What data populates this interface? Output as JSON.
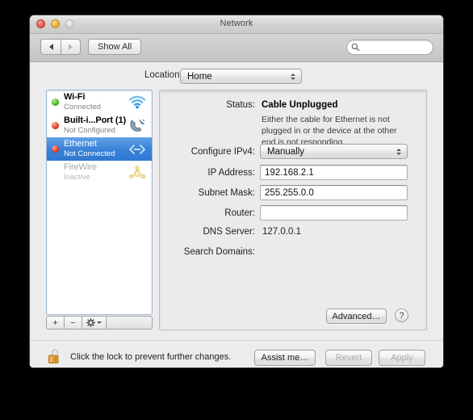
{
  "window": {
    "title": "Network",
    "traffic_lights": [
      "close-button",
      "minimize-button",
      "zoom-button"
    ]
  },
  "toolbar": {
    "back_label": "",
    "forward_label": "",
    "show_all_label": "Show All",
    "search_placeholder": "",
    "search_value": ""
  },
  "location": {
    "label": "Location:",
    "selected": "Home"
  },
  "sidebar": {
    "interfaces": [
      {
        "name": "Wi-Fi",
        "status": "Connected",
        "dot": "green",
        "icon": "wifi-icon",
        "selected": false,
        "dim": false
      },
      {
        "name": "Built-i...Port (1)",
        "status": "Not Configured",
        "dot": "red",
        "icon": "modem-icon",
        "selected": false,
        "dim": false
      },
      {
        "name": "Ethernet",
        "status": "Not Connected",
        "dot": "red",
        "icon": "ethernet-icon",
        "selected": true,
        "dim": false
      },
      {
        "name": "FireWire",
        "status": "Inactive",
        "dot": "none",
        "icon": "firewire-icon",
        "selected": false,
        "dim": true
      }
    ],
    "controls": {
      "add": "+",
      "remove": "−",
      "action": "gear-icon"
    }
  },
  "detail": {
    "status_label": "Status:",
    "status_value": "Cable Unplugged",
    "status_help": "Either the cable for Ethernet is not plugged in or the device at the other end is not responding.",
    "configure_label": "Configure IPv4:",
    "configure_value": "Manually",
    "ip_label": "IP Address:",
    "ip_value": "192.168.2.1",
    "subnet_label": "Subnet Mask:",
    "subnet_value": "255.255.0.0",
    "router_label": "Router:",
    "router_value": "",
    "dns_label": "DNS Server:",
    "dns_value": "127.0.0.1",
    "search_domains_label": "Search Domains:",
    "search_domains_value": "",
    "advanced_label": "Advanced…",
    "help_label": "?"
  },
  "footer": {
    "lock_icon": "unlocked-padlock-icon",
    "lock_text": "Click the lock to prevent further changes.",
    "assist_label": "Assist me…",
    "revert_label": "Revert",
    "apply_label": "Apply"
  },
  "colors": {
    "selection_blue": "#3b82d8",
    "window_bg": "#ececec",
    "panel_bg": "#ebebeb",
    "status_green": "#46b520",
    "status_red": "#e03b22"
  }
}
